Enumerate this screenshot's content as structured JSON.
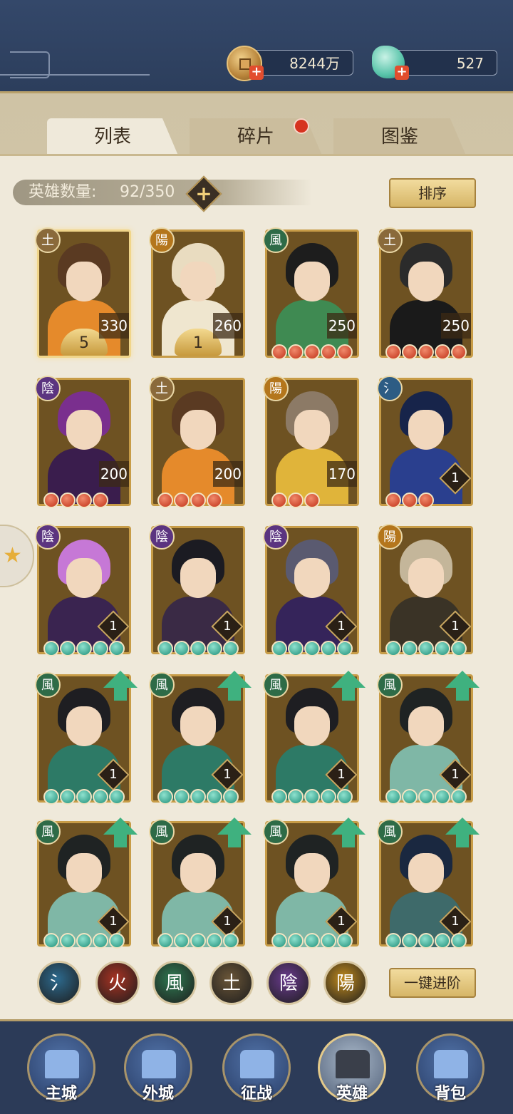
{
  "header": {
    "gold_amount": "8244万",
    "gem_amount": "527"
  },
  "tabs": [
    {
      "label": "列表",
      "active": true
    },
    {
      "label": "碎片",
      "active": false,
      "has_notification": true
    },
    {
      "label": "图鉴",
      "active": false
    }
  ],
  "hero_count": {
    "label": "英雄数量:",
    "value": "92/350"
  },
  "buttons": {
    "sort": "排序",
    "one_click_advance": "一键进阶"
  },
  "elements": {
    "water": "氵",
    "fire": "火",
    "wind": "風",
    "earth": "土",
    "yin": "陰",
    "yang": "陽"
  },
  "heroes": [
    {
      "element": "土",
      "level": "330",
      "stars": "5",
      "bead_color": "gold",
      "beads": 0,
      "upgrade": false,
      "selected": true,
      "palette": "orange"
    },
    {
      "element": "陽",
      "level": "260",
      "stars": "1",
      "bead_color": "gold",
      "beads": 0,
      "upgrade": false,
      "palette": "white"
    },
    {
      "element": "風",
      "level": "250",
      "bead_color": "red",
      "beads": 5,
      "upgrade": false,
      "palette": "green"
    },
    {
      "element": "土",
      "level": "250",
      "bead_color": "red",
      "beads": 5,
      "upgrade": false,
      "palette": "black"
    },
    {
      "element": "陰",
      "level": "200",
      "bead_color": "red",
      "beads": 4,
      "upgrade": false,
      "palette": "purple"
    },
    {
      "element": "土",
      "level": "200",
      "bead_color": "red",
      "beads": 4,
      "upgrade": false,
      "palette": "orange"
    },
    {
      "element": "陽",
      "level": "170",
      "bead_color": "red",
      "beads": 3,
      "upgrade": false,
      "palette": "yellow"
    },
    {
      "element": "氵",
      "level": "1",
      "bead_color": "red",
      "beads": 3,
      "upgrade": false,
      "palette": "blue"
    },
    {
      "element": "陰",
      "level": "1",
      "bead_color": "teal",
      "beads": 5,
      "upgrade": false,
      "palette": "violet"
    },
    {
      "element": "陰",
      "level": "1",
      "bead_color": "teal",
      "beads": 5,
      "upgrade": false,
      "palette": "dark"
    },
    {
      "element": "陰",
      "level": "1",
      "bead_color": "teal",
      "beads": 5,
      "upgrade": false,
      "palette": "indigo"
    },
    {
      "element": "陽",
      "level": "1",
      "bead_color": "teal",
      "beads": 5,
      "upgrade": false,
      "palette": "beige"
    },
    {
      "element": "風",
      "level": "1",
      "bead_color": "teal",
      "beads": 5,
      "upgrade": true,
      "palette": "jade"
    },
    {
      "element": "風",
      "level": "1",
      "bead_color": "teal",
      "beads": 5,
      "upgrade": true,
      "palette": "jade"
    },
    {
      "element": "風",
      "level": "1",
      "bead_color": "teal",
      "beads": 5,
      "upgrade": true,
      "palette": "jade"
    },
    {
      "element": "風",
      "level": "1",
      "bead_color": "teal",
      "beads": 5,
      "upgrade": true,
      "palette": "masked"
    },
    {
      "element": "風",
      "level": "1",
      "bead_color": "teal",
      "beads": 5,
      "upgrade": true,
      "palette": "masked"
    },
    {
      "element": "風",
      "level": "1",
      "bead_color": "teal",
      "beads": 5,
      "upgrade": true,
      "palette": "masked"
    },
    {
      "element": "風",
      "level": "1",
      "bead_color": "teal",
      "beads": 5,
      "upgrade": true,
      "palette": "masked"
    },
    {
      "element": "風",
      "level": "1",
      "bead_color": "teal",
      "beads": 5,
      "upgrade": true,
      "palette": "navy"
    }
  ],
  "filters": [
    {
      "label": "氵",
      "color": "#2d6a8e"
    },
    {
      "label": "火",
      "color": "#a83323"
    },
    {
      "label": "風",
      "color": "#2f7a52"
    },
    {
      "label": "土",
      "color": "#6b5638"
    },
    {
      "label": "陰",
      "color": "#6a3b8e"
    },
    {
      "label": "陽",
      "color": "#c08a1e"
    }
  ],
  "bottom_nav": [
    {
      "label": "主城",
      "active": false,
      "icon": "main-city-icon"
    },
    {
      "label": "外城",
      "active": false,
      "icon": "outer-city-icon"
    },
    {
      "label": "征战",
      "active": false,
      "icon": "battle-icon"
    },
    {
      "label": "英雄",
      "active": true,
      "icon": "hero-icon"
    },
    {
      "label": "背包",
      "active": false,
      "icon": "backpack-icon"
    }
  ],
  "colors": {
    "element_bg": {
      "土": "#8a6a3b",
      "陽": "#b4761c",
      "風": "#2e6b47",
      "陰": "#5b3480",
      "氵": "#2d5c84",
      "火": "#a83323"
    },
    "palettes": {
      "orange": [
        "#5a3a22",
        "#e58a2b"
      ],
      "white": [
        "#e9dcc0",
        "#efe6cf"
      ],
      "green": [
        "#1d1d1d",
        "#3f8a52"
      ],
      "black": [
        "#2b2b2b",
        "#1a1a1a"
      ],
      "purple": [
        "#7a2f8e",
        "#3a1d4d"
      ],
      "yellow": [
        "#8c7a66",
        "#e0b43a"
      ],
      "blue": [
        "#17244a",
        "#2a3f8e"
      ],
      "violet": [
        "#c678d6",
        "#3a2450"
      ],
      "dark": [
        "#1b1b22",
        "#3a2a45"
      ],
      "indigo": [
        "#5a5a70",
        "#35245a"
      ],
      "beige": [
        "#c4b69a",
        "#3a3326"
      ],
      "jade": [
        "#1e1e22",
        "#2d7a66"
      ],
      "masked": [
        "#1f2323",
        "#7fb7a6"
      ],
      "navy": [
        "#1a2840",
        "#3e6a6a"
      ]
    }
  }
}
